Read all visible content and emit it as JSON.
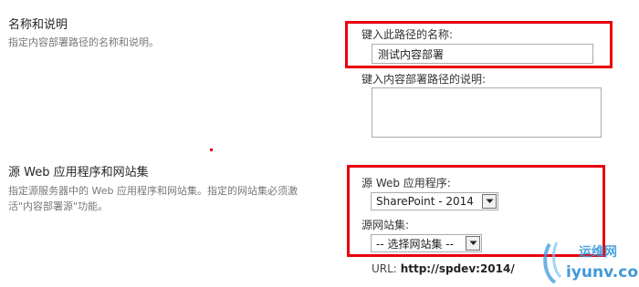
{
  "name_section": {
    "title": "名称和说明",
    "description": "指定内容部署路径的名称和说明。",
    "name_label": "键入此路径的名称:",
    "name_value": "测试内容部署",
    "desc_label": "键入内容部署路径的说明:",
    "desc_value": ""
  },
  "source_section": {
    "title": "源 Web 应用程序和网站集",
    "description_line1": "指定源服务器中的 Web 应用程序和网站集。指定的网站集必须激",
    "description_line2": "活\"内容部署源\"功能。",
    "web_app_label": "源 Web 应用程序:",
    "web_app_selected": "SharePoint - 2014",
    "site_collection_label": "源网站集:",
    "site_collection_selected": "-- 选择网站集 --",
    "url_prefix": "URL:",
    "url_value": "http://spdev:2014/"
  },
  "watermark": {
    "top_text": "运维网",
    "bottom_text": "iyunv.com"
  },
  "colors": {
    "highlight": "#e8000e",
    "input_border": "#ababab",
    "watermark_blue": "#3a9ad9"
  }
}
